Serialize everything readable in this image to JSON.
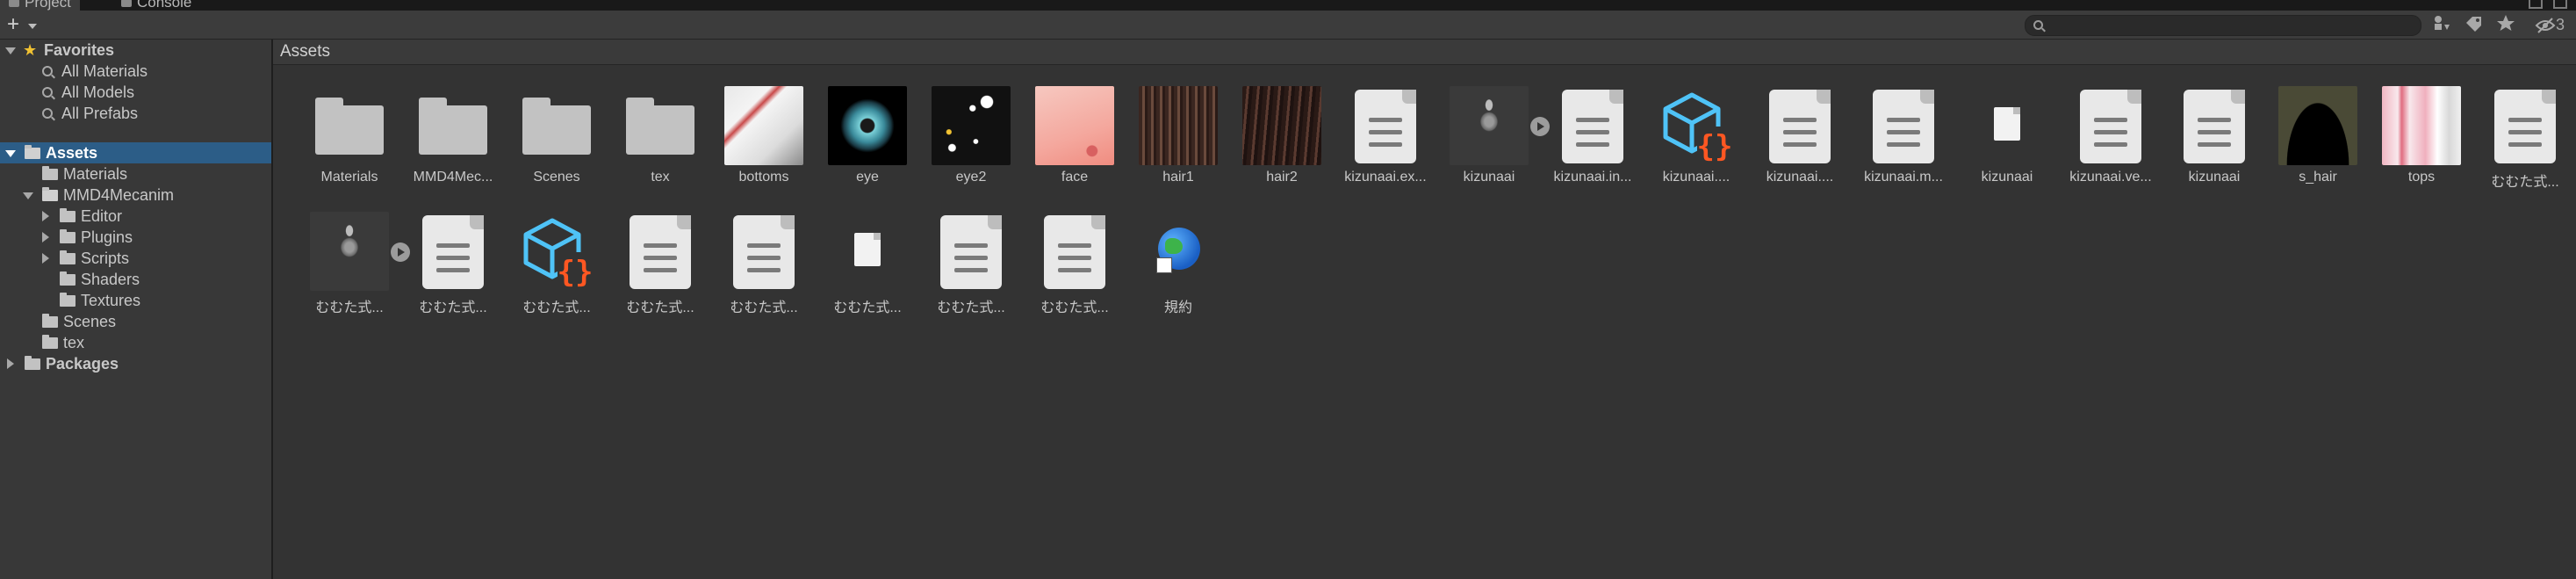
{
  "tabs": [
    {
      "label": "Project",
      "active": true
    },
    {
      "label": "Console",
      "active": false
    }
  ],
  "toolbar": {
    "create_label": "+",
    "search_placeholder": "",
    "hidden_count": "3"
  },
  "tree": {
    "favorites": {
      "label": "Favorites",
      "items": [
        "All Materials",
        "All Models",
        "All Prefabs"
      ]
    },
    "assets": {
      "label": "Assets",
      "children": [
        "Materials",
        "MMD4Mecanim",
        "Scenes",
        "tex"
      ],
      "mmd4mecanim_children": [
        "Editor",
        "Plugins",
        "Scripts",
        "Shaders",
        "Textures"
      ]
    },
    "packages": {
      "label": "Packages"
    }
  },
  "content": {
    "breadcrumb": "Assets",
    "row1": [
      {
        "label": "Materials",
        "icon": "folder-icon"
      },
      {
        "label": "MMD4Mec...",
        "icon": "folder-icon"
      },
      {
        "label": "Scenes",
        "icon": "folder-icon"
      },
      {
        "label": "tex",
        "icon": "folder-icon"
      },
      {
        "label": "bottoms",
        "icon": "texture-thumbnail"
      },
      {
        "label": "eye",
        "icon": "texture-thumbnail"
      },
      {
        "label": "eye2",
        "icon": "texture-thumbnail"
      },
      {
        "label": "face",
        "icon": "texture-thumbnail"
      },
      {
        "label": "hair1",
        "icon": "texture-thumbnail"
      },
      {
        "label": "hair2",
        "icon": "texture-thumbnail"
      },
      {
        "label": "kizunaai.ex...",
        "icon": "document-icon"
      },
      {
        "label": "kizunaai",
        "icon": "model-thumbnail"
      },
      {
        "label": "kizunaai.in...",
        "icon": "document-icon"
      },
      {
        "label": "kizunaai....",
        "icon": "script-asset-icon"
      },
      {
        "label": "kizunaai....",
        "icon": "document-icon"
      },
      {
        "label": "kizunaai.m...",
        "icon": "document-icon"
      },
      {
        "label": "kizunaai",
        "icon": "blank-file-icon"
      },
      {
        "label": "kizunaai.ve...",
        "icon": "document-icon"
      },
      {
        "label": "kizunaai",
        "icon": "document-icon"
      },
      {
        "label": "s_hair",
        "icon": "texture-thumbnail"
      },
      {
        "label": "tops",
        "icon": "texture-thumbnail"
      },
      {
        "label": "むむた式...",
        "icon": "document-icon"
      }
    ],
    "row2": [
      {
        "label": "むむた式...",
        "icon": "model-thumbnail"
      },
      {
        "label": "むむた式...",
        "icon": "document-icon"
      },
      {
        "label": "むむた式...",
        "icon": "script-asset-icon"
      },
      {
        "label": "むむた式...",
        "icon": "document-icon"
      },
      {
        "label": "むむた式...",
        "icon": "document-icon"
      },
      {
        "label": "むむた式...",
        "icon": "blank-file-icon"
      },
      {
        "label": "むむた式...",
        "icon": "document-icon"
      },
      {
        "label": "むむた式...",
        "icon": "document-icon"
      },
      {
        "label": "規約",
        "icon": "web-shortcut-icon"
      }
    ]
  },
  "colors": {
    "selection": "#2c5d87",
    "panel_bg": "#383838",
    "content_bg": "#333333",
    "script_icon_blue": "#4fc3f7",
    "script_icon_orange": "#ff5722",
    "favorite_star": "#f1c232"
  }
}
